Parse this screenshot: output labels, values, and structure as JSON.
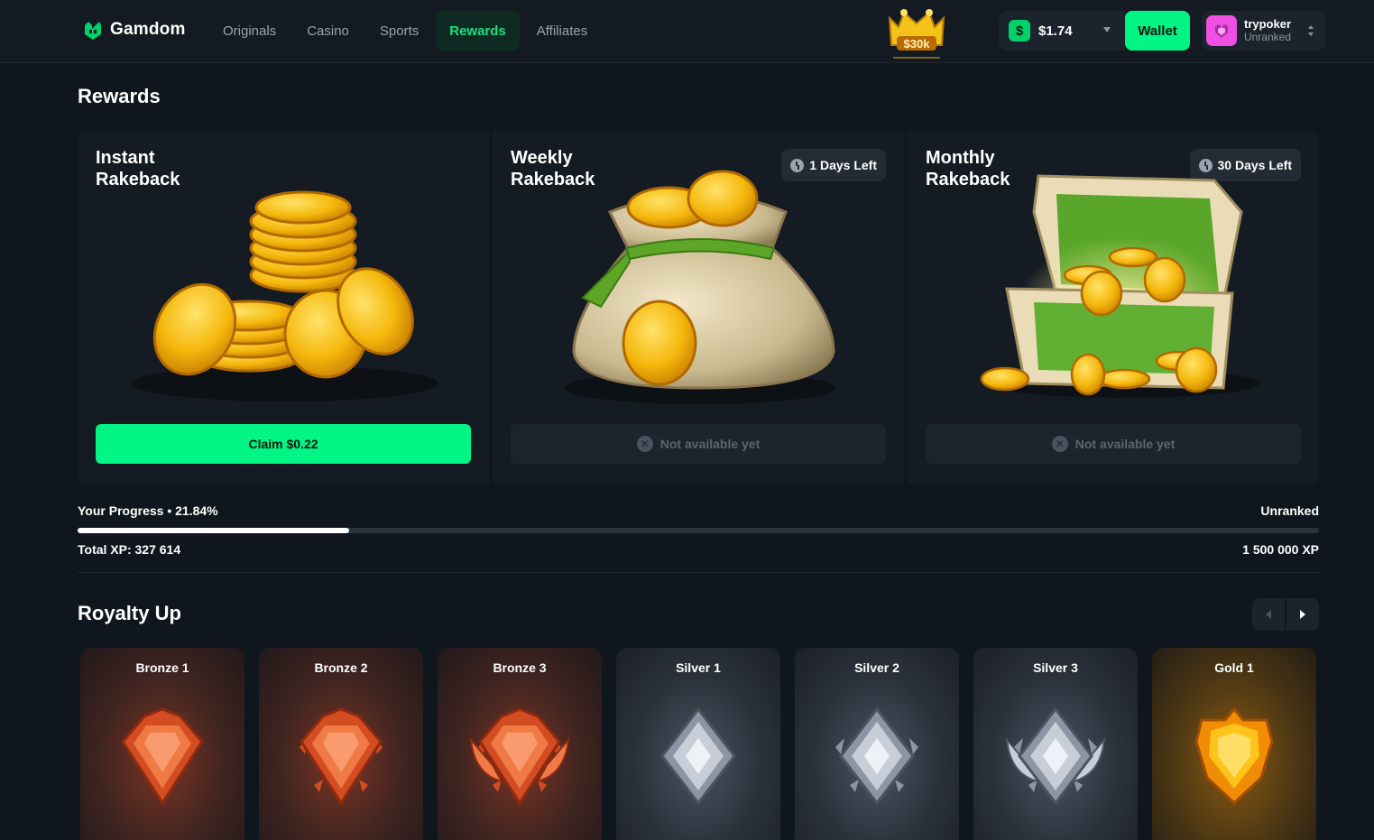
{
  "header": {
    "brand": "Gamdom",
    "nav": [
      {
        "label": "Originals",
        "active": false
      },
      {
        "label": "Casino",
        "active": false
      },
      {
        "label": "Sports",
        "active": false
      },
      {
        "label": "Rewards",
        "active": true
      },
      {
        "label": "Affiliates",
        "active": false
      }
    ],
    "promo_label": "$30k",
    "balance": "$1.74",
    "wallet_label": "Wallet",
    "user": {
      "name": "trypoker",
      "rank": "Unranked"
    }
  },
  "page_title": "Rewards",
  "rewards": [
    {
      "title": "Instant Rakeback",
      "badge": "",
      "action": "Claim  $0.22",
      "available": true
    },
    {
      "title": "Weekly Rakeback",
      "badge": "1 Days Left",
      "action": "Not available yet",
      "available": false
    },
    {
      "title": "Monthly Rakeback",
      "badge": "30 Days Left",
      "action": "Not available yet",
      "available": false
    }
  ],
  "progress": {
    "label": "Your Progress • 21.84%",
    "percent": 21.84,
    "rank": "Unranked",
    "total_xp": "Total XP: 327 614",
    "target_xp": "1 500 000 XP"
  },
  "royalty": {
    "title": "Royalty Up",
    "tiers": [
      {
        "name": "Bronze 1",
        "tier": "bronze"
      },
      {
        "name": "Bronze 2",
        "tier": "bronze"
      },
      {
        "name": "Bronze 3",
        "tier": "bronze"
      },
      {
        "name": "Silver 1",
        "tier": "silver"
      },
      {
        "name": "Silver 2",
        "tier": "silver"
      },
      {
        "name": "Silver 3",
        "tier": "silver"
      },
      {
        "name": "Gold 1",
        "tier": "gold"
      }
    ]
  },
  "colors": {
    "accent": "#00f584",
    "nav_active": "#19e27f",
    "background": "#10161d",
    "card": "#141b22"
  }
}
